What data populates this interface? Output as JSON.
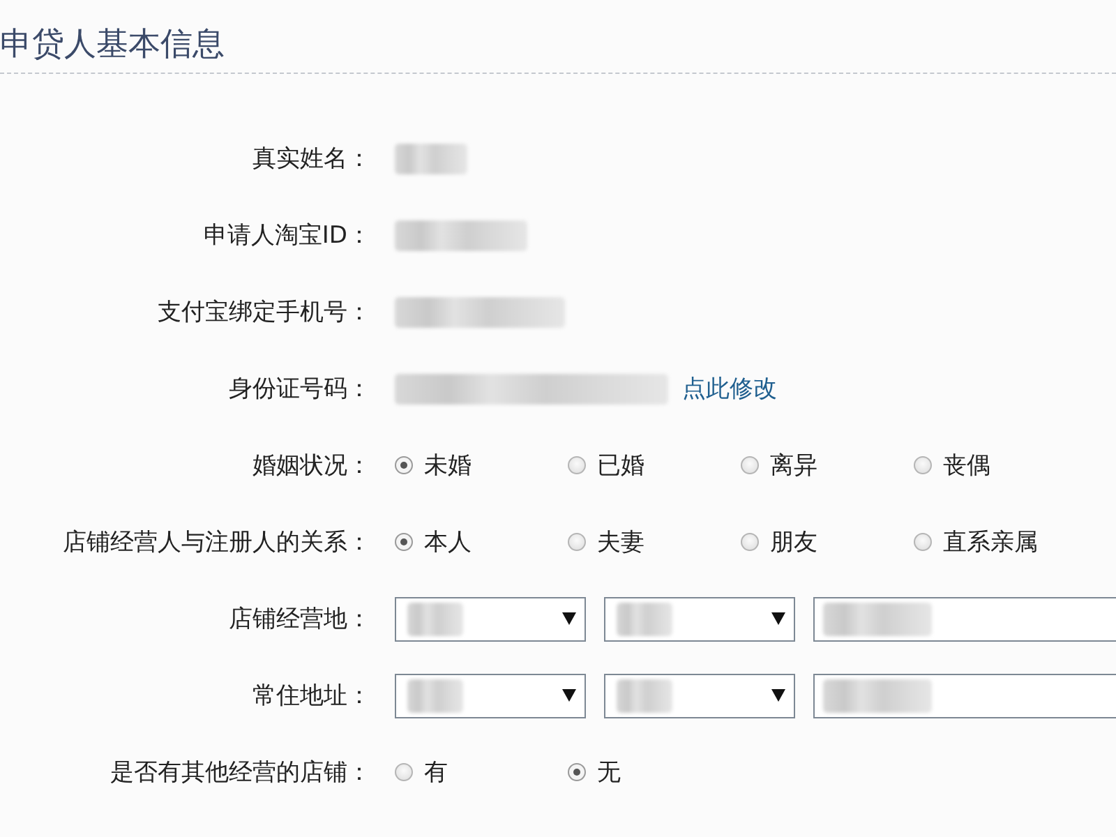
{
  "section": {
    "title": "申贷人基本信息"
  },
  "fields": [
    {
      "kind": "redacted",
      "label": "真实姓名："
    },
    {
      "kind": "redacted",
      "label": "申请人淘宝ID："
    },
    {
      "kind": "redacted",
      "label": "支付宝绑定手机号："
    },
    {
      "kind": "redacted_link",
      "label": "身份证号码：",
      "link": "点此修改"
    },
    {
      "kind": "radio",
      "label": "婚姻状况：",
      "options": [
        {
          "label": "未婚",
          "selected": true
        },
        {
          "label": "已婚",
          "selected": false
        },
        {
          "label": "离异",
          "selected": false
        },
        {
          "label": "丧偶",
          "selected": false
        }
      ]
    },
    {
      "kind": "radio",
      "label": "店铺经营人与注册人的关系：",
      "options": [
        {
          "label": "本人",
          "selected": true
        },
        {
          "label": "夫妻",
          "selected": false
        },
        {
          "label": "朋友",
          "selected": false
        },
        {
          "label": "直系亲属",
          "selected": false
        }
      ]
    },
    {
      "kind": "address",
      "label": "店铺经营地："
    },
    {
      "kind": "address",
      "label": "常住地址："
    },
    {
      "kind": "radio",
      "label": "是否有其他经营的店铺：",
      "options": [
        {
          "label": "有",
          "selected": false
        },
        {
          "label": "无",
          "selected": true
        }
      ]
    }
  ]
}
